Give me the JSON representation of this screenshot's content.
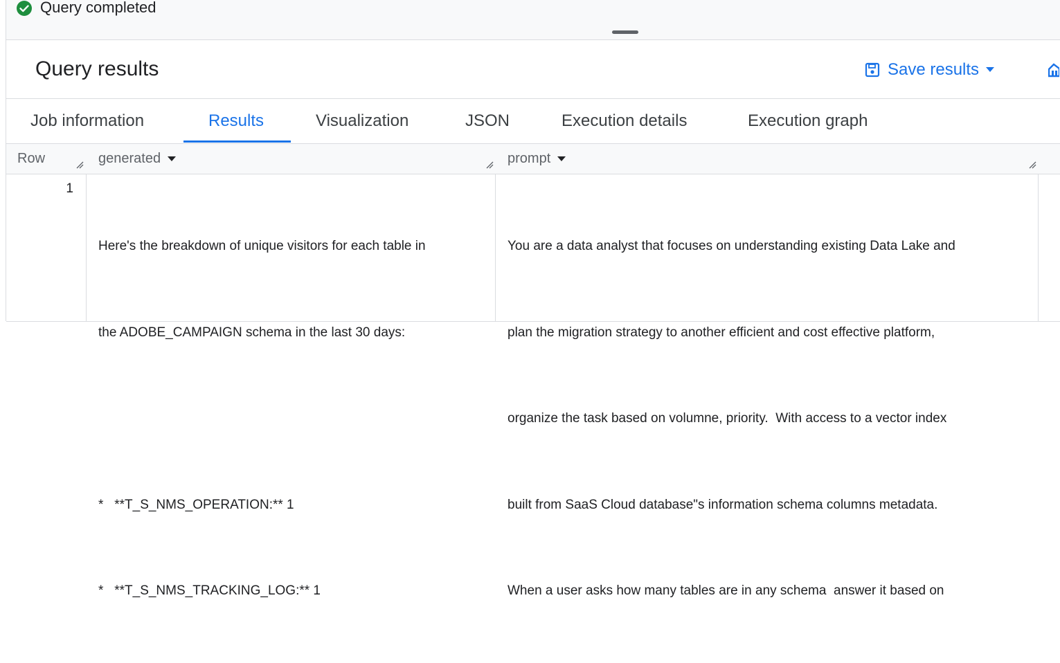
{
  "status": {
    "text": "Query completed",
    "icon": "check-circle-icon",
    "color": "#1e8e3e"
  },
  "results": {
    "title": "Query results",
    "save_label": "Save results",
    "save_icon": "save-icon",
    "explore_icon": "explore-icon"
  },
  "tabs": [
    {
      "label": "Job information"
    },
    {
      "label": "Results",
      "active": true
    },
    {
      "label": "Visualization"
    },
    {
      "label": "JSON"
    },
    {
      "label": "Execution details"
    },
    {
      "label": "Execution graph"
    }
  ],
  "table": {
    "columns": [
      "Row",
      "generated",
      "prompt"
    ],
    "rows": [
      {
        "row": "1",
        "generated": [
          "Here's the breakdown of unique visitors for each table in",
          "the ADOBE_CAMPAIGN schema in the last 30 days:",
          "",
          "*   **T_S_NMS_OPERATION:** 1",
          "*   **T_S_NMS_TRACKING_LOG:** 1"
        ],
        "prompt": [
          "You are a data analyst that focuses on understanding existing Data Lake and",
          "plan the migration strategy to another efficient and cost effective platform,",
          "organize the task based on volumne, priority.  With access to a vector index",
          "built from SaaS Cloud database\"s information schema columns metadata.",
          "When a user asks how many tables are in any schema  answer it based on"
        ]
      }
    ]
  },
  "colors": {
    "accent": "#1a73e8",
    "border": "#dadce0",
    "header_bg": "#f8f9fa"
  }
}
